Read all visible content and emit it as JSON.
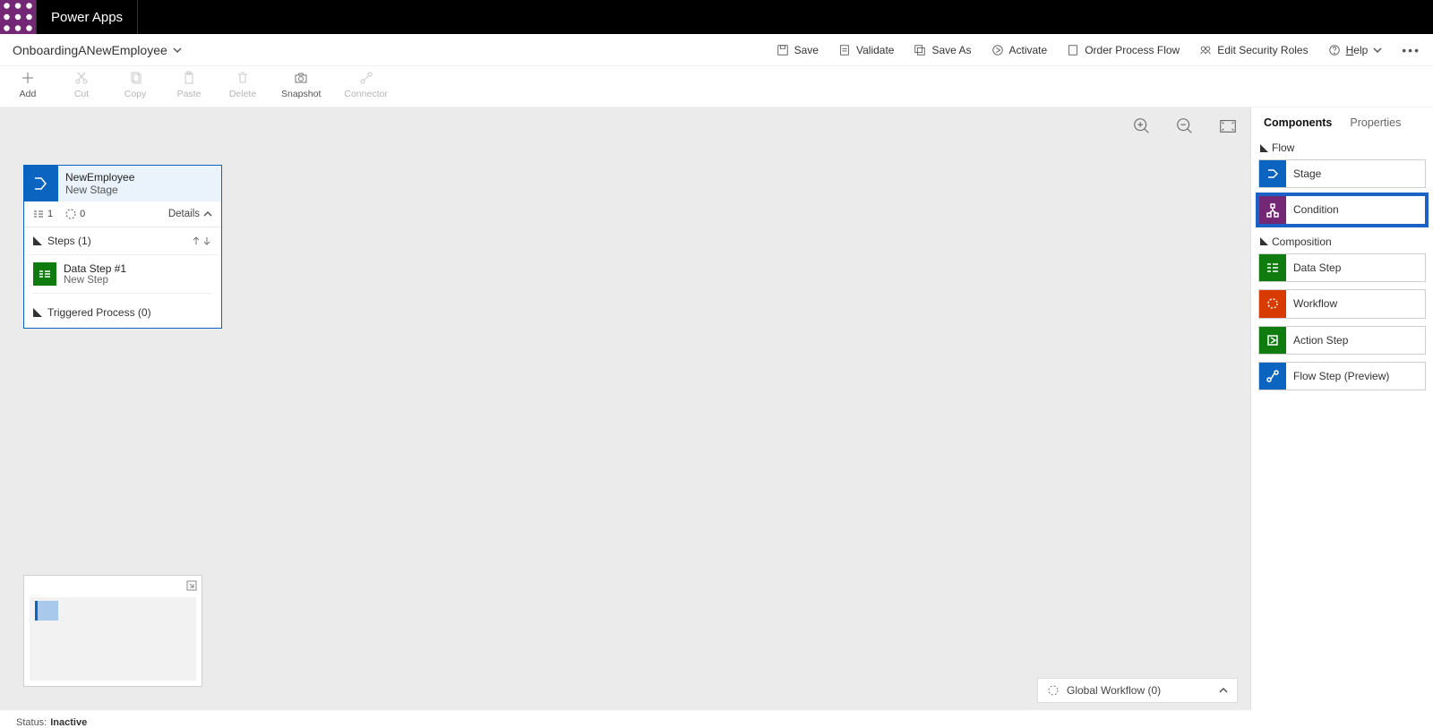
{
  "app": {
    "name": "Power Apps"
  },
  "flow": {
    "name": "OnboardingANewEmployee"
  },
  "top_commands": {
    "save": "Save",
    "validate": "Validate",
    "save_as": "Save As",
    "activate": "Activate",
    "order": "Order Process Flow",
    "security": "Edit Security Roles",
    "help": "Help"
  },
  "toolbar": {
    "add": "Add",
    "cut": "Cut",
    "copy": "Copy",
    "paste": "Paste",
    "delete": "Delete",
    "snapshot": "Snapshot",
    "connector": "Connector"
  },
  "stage": {
    "title": "NewEmployee",
    "subtitle": "New Stage",
    "steps_count": "1",
    "workflow_count": "0",
    "details_label": "Details",
    "steps_section": "Steps (1)",
    "step1_title": "Data Step #1",
    "step1_subtitle": "New Step",
    "trig_section": "Triggered Process (0)"
  },
  "global_workflow": {
    "label": "Global Workflow (0)"
  },
  "side": {
    "tab_components": "Components",
    "tab_properties": "Properties",
    "flow_head": "Flow",
    "composition_head": "Composition",
    "stage": "Stage",
    "condition": "Condition",
    "data_step": "Data Step",
    "workflow": "Workflow",
    "action_step": "Action Step",
    "flow_step": "Flow Step (Preview)"
  },
  "status": {
    "label": "Status:",
    "value": "Inactive"
  }
}
